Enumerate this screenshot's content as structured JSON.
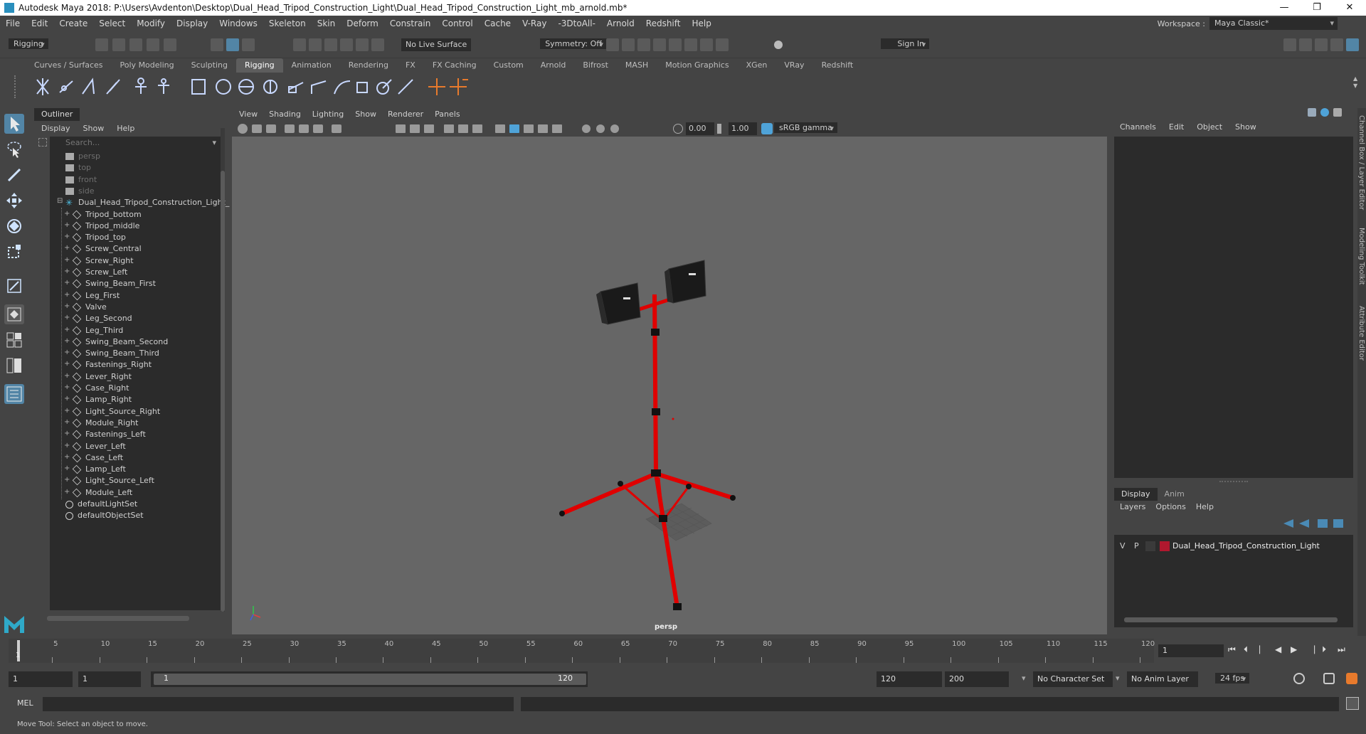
{
  "window": {
    "title": "Autodesk Maya 2018: P:\\Users\\Avdenton\\Desktop\\Dual_Head_Tripod_Construction_Light\\Dual_Head_Tripod_Construction_Light_mb_arnold.mb*",
    "minimize": "—",
    "maximize": "❐",
    "close": "✕"
  },
  "menubar": {
    "items": [
      "File",
      "Edit",
      "Create",
      "Select",
      "Modify",
      "Display",
      "Windows",
      "Skeleton",
      "Skin",
      "Deform",
      "Constrain",
      "Control",
      "Cache",
      "V-Ray",
      "-3DtoAll-",
      "Arnold",
      "Redshift",
      "Help"
    ],
    "workspace_label": "Workspace :",
    "workspace_value": "Maya Classic*"
  },
  "statusline": {
    "mode": "Rigging",
    "live_surface": "No Live Surface",
    "symmetry": "Symmetry: Off",
    "sign_in": "Sign In"
  },
  "shelf": {
    "tabs": [
      "Curves / Surfaces",
      "Poly Modeling",
      "Sculpting",
      "Rigging",
      "Animation",
      "Rendering",
      "FX",
      "FX Caching",
      "Custom",
      "Arnold",
      "Bifrost",
      "MASH",
      "Motion Graphics",
      "XGen",
      "VRay",
      "Redshift"
    ],
    "active_tab": "Rigging"
  },
  "outliner": {
    "tab": "Outliner",
    "menu": [
      "Display",
      "Show",
      "Help"
    ],
    "search_placeholder": "Search...",
    "cameras": [
      "persp",
      "top",
      "front",
      "side"
    ],
    "group": "Dual_Head_Tripod_Construction_Light_",
    "children": [
      "Tripod_bottom",
      "Tripod_middle",
      "Tripod_top",
      "Screw_Central",
      "Screw_Right",
      "Screw_Left",
      "Swing_Beam_First",
      "Leg_First",
      "Valve",
      "Leg_Second",
      "Leg_Third",
      "Swing_Beam_Second",
      "Swing_Beam_Third",
      "Fastenings_Right",
      "Lever_Right",
      "Case_Right",
      "Lamp_Right",
      "Light_Source_Right",
      "Module_Right",
      "Fastenings_Left",
      "Lever_Left",
      "Case_Left",
      "Lamp_Left",
      "Light_Source_Left",
      "Module_Left"
    ],
    "sets": [
      "defaultLightSet",
      "defaultObjectSet"
    ]
  },
  "viewport": {
    "menu": [
      "View",
      "Shading",
      "Lighting",
      "Show",
      "Renderer",
      "Panels"
    ],
    "field_a": "0.00",
    "field_b": "1.00",
    "color_space": "sRGB gamma",
    "camera_label": "persp"
  },
  "channel_box": {
    "menu": [
      "Channels",
      "Edit",
      "Object",
      "Show"
    ],
    "side_tabs": [
      "Channel Box / Layer Editor",
      "Modeling Toolkit",
      "Attribute Editor"
    ]
  },
  "layer_editor": {
    "tabs": [
      "Display",
      "Anim"
    ],
    "active_tab": "Display",
    "menu": [
      "Layers",
      "Options",
      "Help"
    ],
    "layer": {
      "v": "V",
      "p": "P",
      "name": "Dual_Head_Tripod_Construction_Light",
      "color": "#b0182e"
    }
  },
  "timeline": {
    "ticks": [
      5,
      10,
      15,
      20,
      25,
      30,
      35,
      40,
      45,
      50,
      55,
      60,
      65,
      70,
      75,
      80,
      85,
      90,
      95,
      100,
      105,
      110,
      115,
      120
    ],
    "start_marker": "1",
    "current_frame": "1"
  },
  "range": {
    "start": "1",
    "playback_start": "1",
    "slider_start": "1",
    "slider_end": "120",
    "playback_end": "120",
    "end": "200",
    "character_set": "No Character Set",
    "anim_layer": "No Anim Layer",
    "fps": "24 fps"
  },
  "command": {
    "label": "MEL"
  },
  "help_line": "Move Tool: Select an object to move.",
  "colors": {
    "tripod_red": "#e00000",
    "active_blue": "#5285a6",
    "panel_dark": "#2b2b2b"
  }
}
